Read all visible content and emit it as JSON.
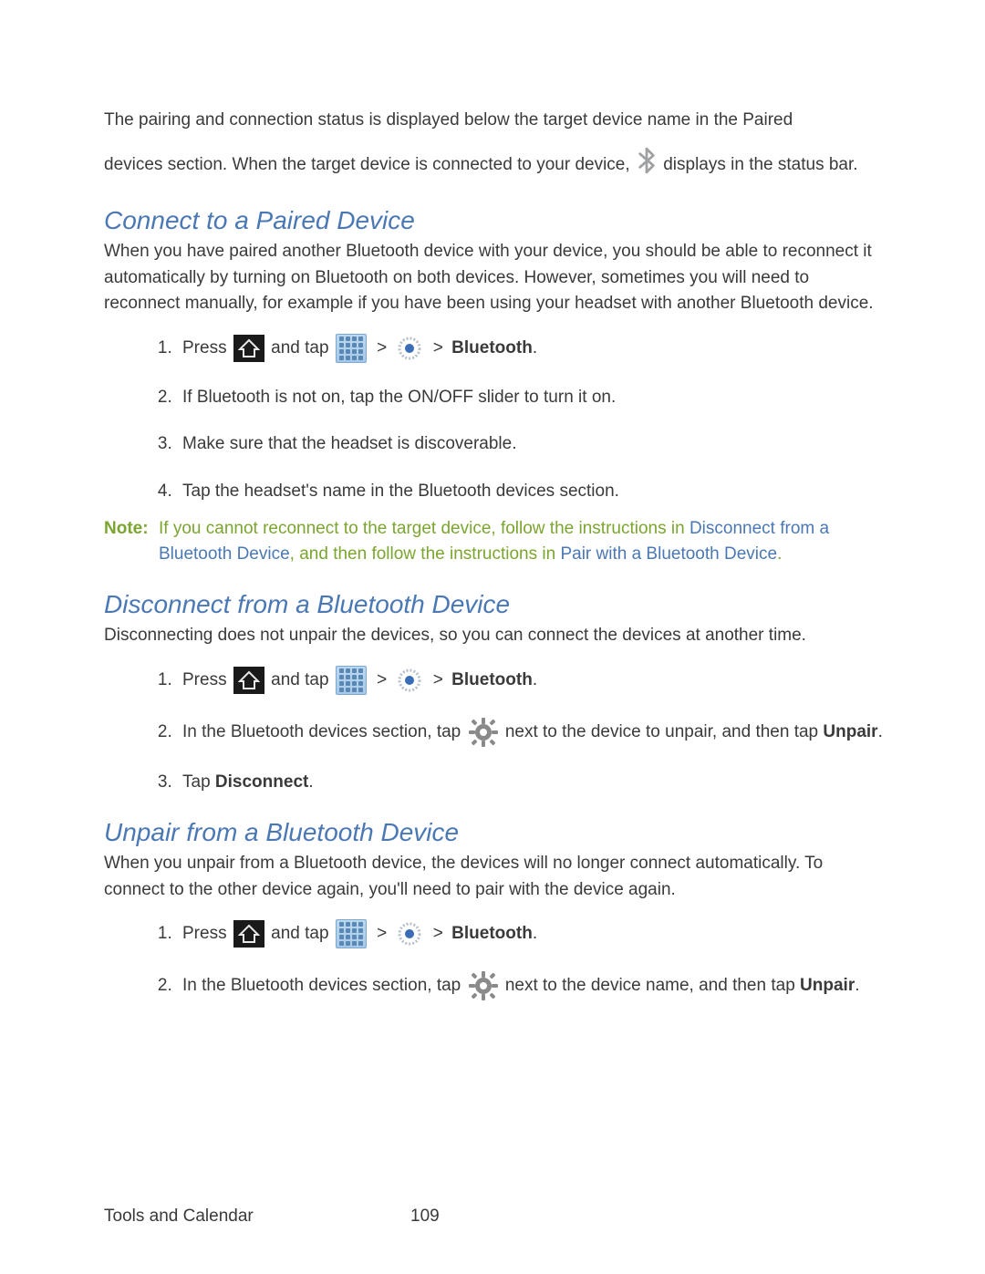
{
  "intro": {
    "p1a": "The pairing and connection status is displayed below the target device name in the Paired",
    "p1b": "devices section. When the target device is connected to your device, ",
    "p1c": "displays in the status bar."
  },
  "sections": {
    "connect": {
      "heading": "Connect to a Paired Device",
      "intro": "When you have paired another Bluetooth device with your device, you should be able to reconnect it automatically by turning on Bluetooth on both devices. However, sometimes you will need to reconnect manually, for example if you have been using your headset with another Bluetooth device.",
      "steps": {
        "s1_press": "Press ",
        "s1_andtap": "and tap ",
        "s1_bt": "Bluetooth",
        "s1_dot": ".",
        "s2": "If Bluetooth is not on, tap the ON/OFF slider to turn it on.",
        "s3": "Make sure that the headset is discoverable.",
        "s4": "Tap the headset's name in the Bluetooth devices section."
      },
      "note": {
        "label": "Note:",
        "t1": "If you cannot reconnect to the target device, follow the instructions in ",
        "link1": "Disconnect from a Bluetooth Device",
        "t2": ", and then follow the instructions in ",
        "link2": "Pair with a Bluetooth Device",
        "t3": "."
      }
    },
    "disconnect": {
      "heading": "Disconnect from a Bluetooth Device",
      "intro": "Disconnecting does not unpair the devices, so you can connect the devices at another time.",
      "steps": {
        "s1_press": "Press ",
        "s1_andtap": "and tap ",
        "s1_bt": "Bluetooth",
        "s1_dot": ".",
        "s2a": "In the Bluetooth devices section, tap ",
        "s2b": "next to the device to unpair, and then tap ",
        "s2_unpair": "Unpair",
        "s2_dot": ".",
        "s3a": "Tap ",
        "s3_disc": "Disconnect",
        "s3_dot": "."
      }
    },
    "unpair": {
      "heading": "Unpair from a Bluetooth Device",
      "intro": "When you unpair from a Bluetooth device, the devices will no longer connect automatically. To connect to the other device again, you'll need to pair with the device again.",
      "steps": {
        "s1_press": "Press ",
        "s1_andtap": "and tap ",
        "s1_bt": "Bluetooth",
        "s1_dot": ".",
        "s2a": "In the Bluetooth devices section, tap ",
        "s2b": " next to the device name, and then tap ",
        "s2_unpair": "Unpair",
        "s2_dot": "."
      }
    }
  },
  "nav": {
    "gt": ">"
  },
  "footer": {
    "section": "Tools and Calendar",
    "page": "109"
  }
}
